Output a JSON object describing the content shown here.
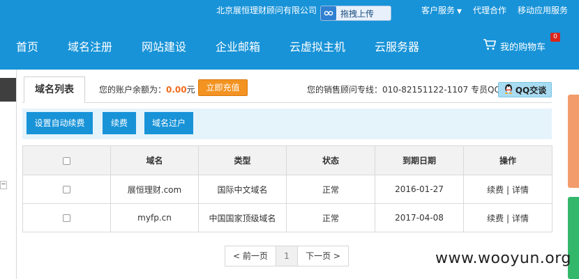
{
  "topbar": {
    "company": "北京展恒理财顾问有限公司",
    "links": [
      {
        "label": "客户服务",
        "caret": "▼"
      },
      {
        "label": "代理合作"
      },
      {
        "label": "移动应用服务"
      }
    ]
  },
  "upload_widget": {
    "label": "拖拽上传"
  },
  "nav": {
    "items": [
      "首页",
      "域名注册",
      "网站建设",
      "企业邮箱",
      "云虚拟主机",
      "云服务器"
    ],
    "cart_label": "我的购物车",
    "cart_count": "0"
  },
  "account": {
    "tab_label": "域名列表",
    "balance_prefix": "您的账户余额为：",
    "balance_amount": "0.00",
    "balance_unit": "元",
    "recharge_label": "立即充值",
    "advisor_text": "您的销售顾问专线：010-82151122-1107 专员QQ",
    "qq_label": "QQ交谈"
  },
  "actions": [
    "设置自动续费",
    "续费",
    "域名过户"
  ],
  "table": {
    "headers": [
      "域名",
      "类型",
      "状态",
      "到期日期",
      "操作"
    ],
    "rows": [
      {
        "domain": "展恒理财.com",
        "type": "国际中文域名",
        "status": "正常",
        "expiry": "2016-01-27",
        "op_renew": "续费",
        "op_sep": "|",
        "op_detail": "详情"
      },
      {
        "domain": "myfp.cn",
        "type": "中国国家顶级域名",
        "status": "正常",
        "expiry": "2017-04-08",
        "op_renew": "续费",
        "op_sep": "|",
        "op_detail": "详情"
      }
    ]
  },
  "pagination": {
    "prev": "< 前一页",
    "current": "1",
    "next": "下一页 >"
  },
  "watermark": "www.wooyun.org",
  "colors": {
    "brand_blue": "#1893d8",
    "recharge_orange": "#f39321",
    "balance_orange": "#f26b1d",
    "side_orange": "#f39c6b",
    "side_green": "#33b76a"
  },
  "icons": [
    "upload-icon",
    "cart-icon",
    "qq-penguin-icon",
    "checkbox-icon"
  ]
}
